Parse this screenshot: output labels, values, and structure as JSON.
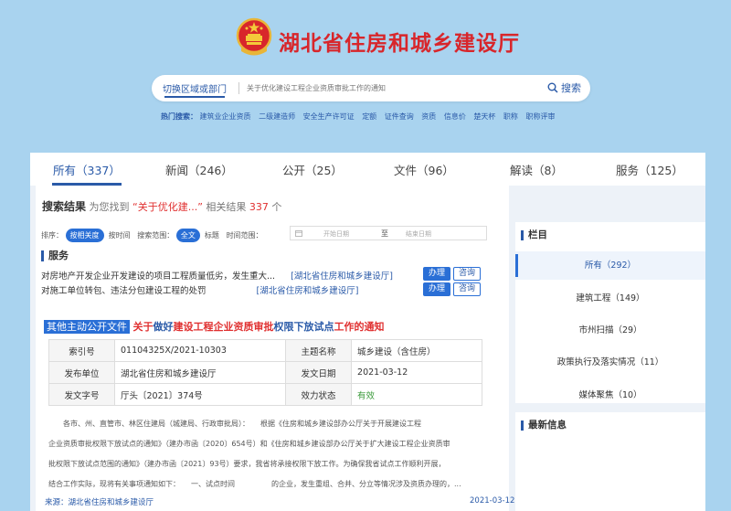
{
  "header": {
    "site_title": "湖北省住房和城乡建设厅",
    "region_switch": "切换区域或部门",
    "search_placeholder": "关于优化建设工程企业资质审批工作的通知",
    "search_button": "搜索",
    "hot_label": "热门搜索：",
    "hot_terms": [
      "建筑业企业资质",
      "二级建造师",
      "安全生产许可证",
      "定额",
      "证件查询",
      "资质",
      "信息价",
      "楚天杯",
      "职称",
      "职称评审"
    ]
  },
  "tabs": [
    {
      "label": "所有（337）",
      "active": true
    },
    {
      "label": "新闻（246）"
    },
    {
      "label": "公开（25）"
    },
    {
      "label": "文件（96）"
    },
    {
      "label": "解读（8）"
    },
    {
      "label": "服务（125）"
    }
  ],
  "results": {
    "heading": "搜索结果",
    "found_prefix": "为您找到",
    "query": "“关于优化建...”",
    "related_label": "相关结果",
    "count": "337",
    "count_unit": "个"
  },
  "filters": {
    "sort_label": "排序：",
    "sort_relevance": "按相关度",
    "sort_time": "按时间",
    "scope_label": "搜索范围：",
    "scope_all": "全文",
    "scope_title": "标题",
    "time_label": "时间范围：",
    "start_date": "开始日期",
    "to": "至",
    "end_date": "结束日期"
  },
  "service": {
    "title": "服务",
    "items": [
      {
        "text": "对房地产开发企业开发建设的项目工程质量低劣，发生重大...",
        "org": "[湖北省住房和城乡建设厅]",
        "do_label": "办理",
        "ask_label": "咨询"
      },
      {
        "text": "对施工单位转包、违法分包建设工程的处罚",
        "org": "[湖北省住房和城乡建设厅]",
        "do_label": "办理",
        "ask_label": "咨询"
      }
    ]
  },
  "doc": {
    "tag": "其他主动公开文件",
    "title_parts": [
      "关于",
      "做好",
      "建设工程企业资质审批",
      "权限下放试点",
      "工作的通知"
    ],
    "meta": [
      {
        "k1": "索引号",
        "v1": "01104325X/2021-10303",
        "k2": "主题名称",
        "v2": "城乡建设（含住房）"
      },
      {
        "k1": "发布单位",
        "v1": "湖北省住房和城乡建设厅",
        "k2": "发文日期",
        "v2": "2021-03-12"
      },
      {
        "k1": "发文字号",
        "v1": "厅头〔2021〕374号",
        "k2": "效力状态",
        "v2": "有效"
      }
    ],
    "body_lines": [
      "　　各市、州、直管市、林区住建局（城建局、行政审批局）：　　根据《住房和城乡建设部办公厅关于开展建设工程",
      "企业资质审批权限下放试点的通知》（建办市函〔2020〕654号）和《住房和城乡建设部办公厅关于扩大建设工程企业资质审",
      "批权限下放试点范围的通知》（建办市函〔2021〕93号）要求，我省将承接权限下放工作。为确保我省试点工作顺利开展，",
      "结合工作实际，现将有关事项通知如下：　　一、试点时间　　　　　的企业，发生重组、合并、分立等情况涉及资质办理的，..."
    ],
    "source": "来源：湖北省住房和城乡建设厅",
    "date": "2021-03-12"
  },
  "sidebar": {
    "column_title": "栏目",
    "items": [
      {
        "label": "所有（292）",
        "active": true
      },
      {
        "label": "建筑工程（149）"
      },
      {
        "label": "市州扫描（29）"
      },
      {
        "label": "政策执行及落实情况（11）"
      },
      {
        "label": "媒体聚焦（10）"
      }
    ],
    "latest_title": "最新信息"
  },
  "colors": {
    "brand_red": "#d8262b",
    "accent_blue": "#2a6fd6",
    "page_bg": "#a9d3ef"
  }
}
